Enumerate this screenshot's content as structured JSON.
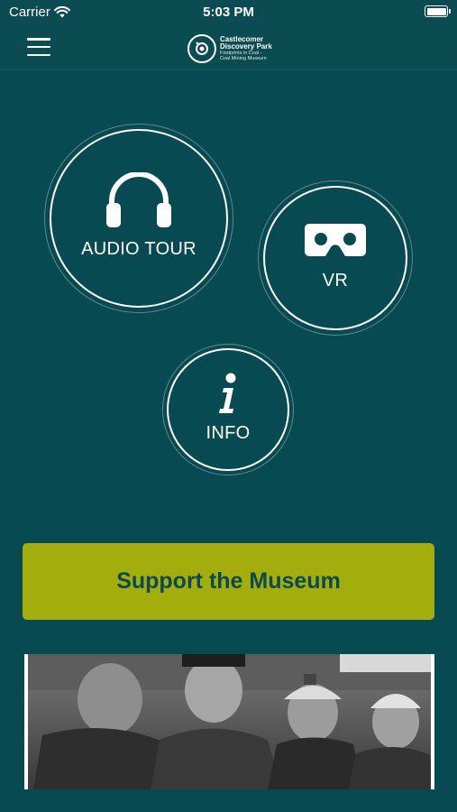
{
  "status_bar": {
    "carrier": "Carrier",
    "time": "5:03 PM"
  },
  "header": {
    "logo": {
      "line1": "Castlecomer",
      "line2": "Discovery Park",
      "line3": "Footprints in Coal -",
      "line4": "Coal Mining Museum"
    }
  },
  "menu": {
    "audio_tour": {
      "label": "AUDIO TOUR",
      "icon": "headphones-icon"
    },
    "vr": {
      "label": "VR",
      "icon": "vr-headset-icon"
    },
    "info": {
      "label": "INFO",
      "icon": "info-icon"
    }
  },
  "support_button": {
    "label": "Support the Museum"
  },
  "colors": {
    "background": "#084a51",
    "accent": "#a3ad0b",
    "text": "#ffffff"
  }
}
